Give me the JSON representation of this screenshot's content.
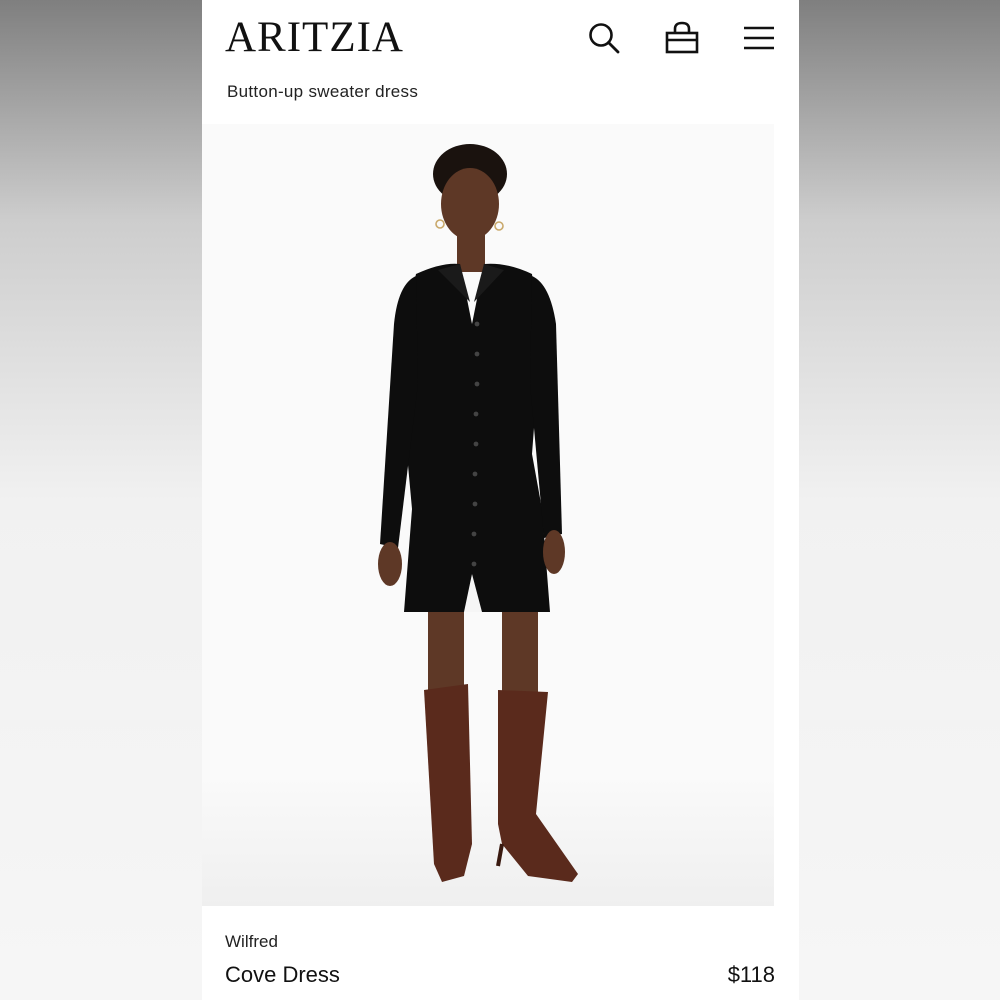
{
  "header": {
    "logo": "ARITZIA",
    "subtitle": "Button-up sweater dress",
    "icons": [
      "search-icon",
      "shopping-bag-icon",
      "menu-icon"
    ]
  },
  "product": {
    "brand": "Wilfred",
    "name": "Cove Dress",
    "price": "$118"
  },
  "colors": {
    "dress": "#0d0d0d",
    "boots": "#5a2a1c",
    "skin": "#6b3f2a",
    "background": "#fafafa"
  }
}
